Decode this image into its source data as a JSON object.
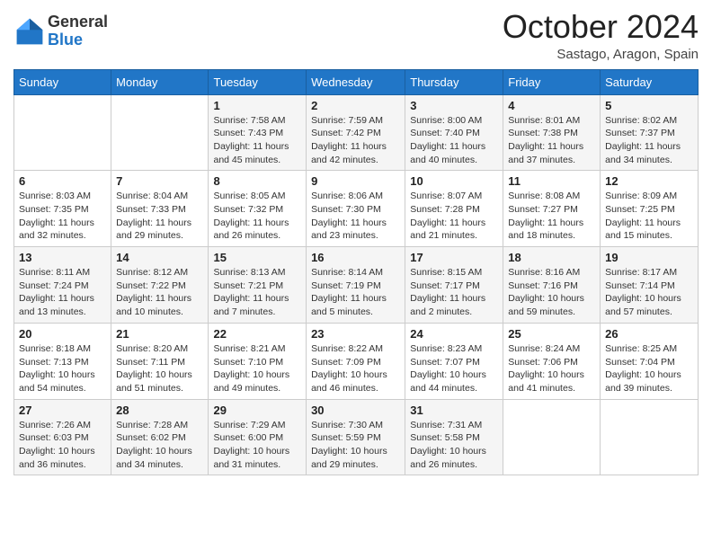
{
  "logo": {
    "general": "General",
    "blue": "Blue"
  },
  "header": {
    "title": "October 2024",
    "location": "Sastago, Aragon, Spain"
  },
  "days_of_week": [
    "Sunday",
    "Monday",
    "Tuesday",
    "Wednesday",
    "Thursday",
    "Friday",
    "Saturday"
  ],
  "weeks": [
    [
      null,
      null,
      {
        "day": "1",
        "sunrise": "Sunrise: 7:58 AM",
        "sunset": "Sunset: 7:43 PM",
        "daylight": "Daylight: 11 hours and 45 minutes."
      },
      {
        "day": "2",
        "sunrise": "Sunrise: 7:59 AM",
        "sunset": "Sunset: 7:42 PM",
        "daylight": "Daylight: 11 hours and 42 minutes."
      },
      {
        "day": "3",
        "sunrise": "Sunrise: 8:00 AM",
        "sunset": "Sunset: 7:40 PM",
        "daylight": "Daylight: 11 hours and 40 minutes."
      },
      {
        "day": "4",
        "sunrise": "Sunrise: 8:01 AM",
        "sunset": "Sunset: 7:38 PM",
        "daylight": "Daylight: 11 hours and 37 minutes."
      },
      {
        "day": "5",
        "sunrise": "Sunrise: 8:02 AM",
        "sunset": "Sunset: 7:37 PM",
        "daylight": "Daylight: 11 hours and 34 minutes."
      }
    ],
    [
      {
        "day": "6",
        "sunrise": "Sunrise: 8:03 AM",
        "sunset": "Sunset: 7:35 PM",
        "daylight": "Daylight: 11 hours and 32 minutes."
      },
      {
        "day": "7",
        "sunrise": "Sunrise: 8:04 AM",
        "sunset": "Sunset: 7:33 PM",
        "daylight": "Daylight: 11 hours and 29 minutes."
      },
      {
        "day": "8",
        "sunrise": "Sunrise: 8:05 AM",
        "sunset": "Sunset: 7:32 PM",
        "daylight": "Daylight: 11 hours and 26 minutes."
      },
      {
        "day": "9",
        "sunrise": "Sunrise: 8:06 AM",
        "sunset": "Sunset: 7:30 PM",
        "daylight": "Daylight: 11 hours and 23 minutes."
      },
      {
        "day": "10",
        "sunrise": "Sunrise: 8:07 AM",
        "sunset": "Sunset: 7:28 PM",
        "daylight": "Daylight: 11 hours and 21 minutes."
      },
      {
        "day": "11",
        "sunrise": "Sunrise: 8:08 AM",
        "sunset": "Sunset: 7:27 PM",
        "daylight": "Daylight: 11 hours and 18 minutes."
      },
      {
        "day": "12",
        "sunrise": "Sunrise: 8:09 AM",
        "sunset": "Sunset: 7:25 PM",
        "daylight": "Daylight: 11 hours and 15 minutes."
      }
    ],
    [
      {
        "day": "13",
        "sunrise": "Sunrise: 8:11 AM",
        "sunset": "Sunset: 7:24 PM",
        "daylight": "Daylight: 11 hours and 13 minutes."
      },
      {
        "day": "14",
        "sunrise": "Sunrise: 8:12 AM",
        "sunset": "Sunset: 7:22 PM",
        "daylight": "Daylight: 11 hours and 10 minutes."
      },
      {
        "day": "15",
        "sunrise": "Sunrise: 8:13 AM",
        "sunset": "Sunset: 7:21 PM",
        "daylight": "Daylight: 11 hours and 7 minutes."
      },
      {
        "day": "16",
        "sunrise": "Sunrise: 8:14 AM",
        "sunset": "Sunset: 7:19 PM",
        "daylight": "Daylight: 11 hours and 5 minutes."
      },
      {
        "day": "17",
        "sunrise": "Sunrise: 8:15 AM",
        "sunset": "Sunset: 7:17 PM",
        "daylight": "Daylight: 11 hours and 2 minutes."
      },
      {
        "day": "18",
        "sunrise": "Sunrise: 8:16 AM",
        "sunset": "Sunset: 7:16 PM",
        "daylight": "Daylight: 10 hours and 59 minutes."
      },
      {
        "day": "19",
        "sunrise": "Sunrise: 8:17 AM",
        "sunset": "Sunset: 7:14 PM",
        "daylight": "Daylight: 10 hours and 57 minutes."
      }
    ],
    [
      {
        "day": "20",
        "sunrise": "Sunrise: 8:18 AM",
        "sunset": "Sunset: 7:13 PM",
        "daylight": "Daylight: 10 hours and 54 minutes."
      },
      {
        "day": "21",
        "sunrise": "Sunrise: 8:20 AM",
        "sunset": "Sunset: 7:11 PM",
        "daylight": "Daylight: 10 hours and 51 minutes."
      },
      {
        "day": "22",
        "sunrise": "Sunrise: 8:21 AM",
        "sunset": "Sunset: 7:10 PM",
        "daylight": "Daylight: 10 hours and 49 minutes."
      },
      {
        "day": "23",
        "sunrise": "Sunrise: 8:22 AM",
        "sunset": "Sunset: 7:09 PM",
        "daylight": "Daylight: 10 hours and 46 minutes."
      },
      {
        "day": "24",
        "sunrise": "Sunrise: 8:23 AM",
        "sunset": "Sunset: 7:07 PM",
        "daylight": "Daylight: 10 hours and 44 minutes."
      },
      {
        "day": "25",
        "sunrise": "Sunrise: 8:24 AM",
        "sunset": "Sunset: 7:06 PM",
        "daylight": "Daylight: 10 hours and 41 minutes."
      },
      {
        "day": "26",
        "sunrise": "Sunrise: 8:25 AM",
        "sunset": "Sunset: 7:04 PM",
        "daylight": "Daylight: 10 hours and 39 minutes."
      }
    ],
    [
      {
        "day": "27",
        "sunrise": "Sunrise: 7:26 AM",
        "sunset": "Sunset: 6:03 PM",
        "daylight": "Daylight: 10 hours and 36 minutes."
      },
      {
        "day": "28",
        "sunrise": "Sunrise: 7:28 AM",
        "sunset": "Sunset: 6:02 PM",
        "daylight": "Daylight: 10 hours and 34 minutes."
      },
      {
        "day": "29",
        "sunrise": "Sunrise: 7:29 AM",
        "sunset": "Sunset: 6:00 PM",
        "daylight": "Daylight: 10 hours and 31 minutes."
      },
      {
        "day": "30",
        "sunrise": "Sunrise: 7:30 AM",
        "sunset": "Sunset: 5:59 PM",
        "daylight": "Daylight: 10 hours and 29 minutes."
      },
      {
        "day": "31",
        "sunrise": "Sunrise: 7:31 AM",
        "sunset": "Sunset: 5:58 PM",
        "daylight": "Daylight: 10 hours and 26 minutes."
      },
      null,
      null
    ]
  ]
}
